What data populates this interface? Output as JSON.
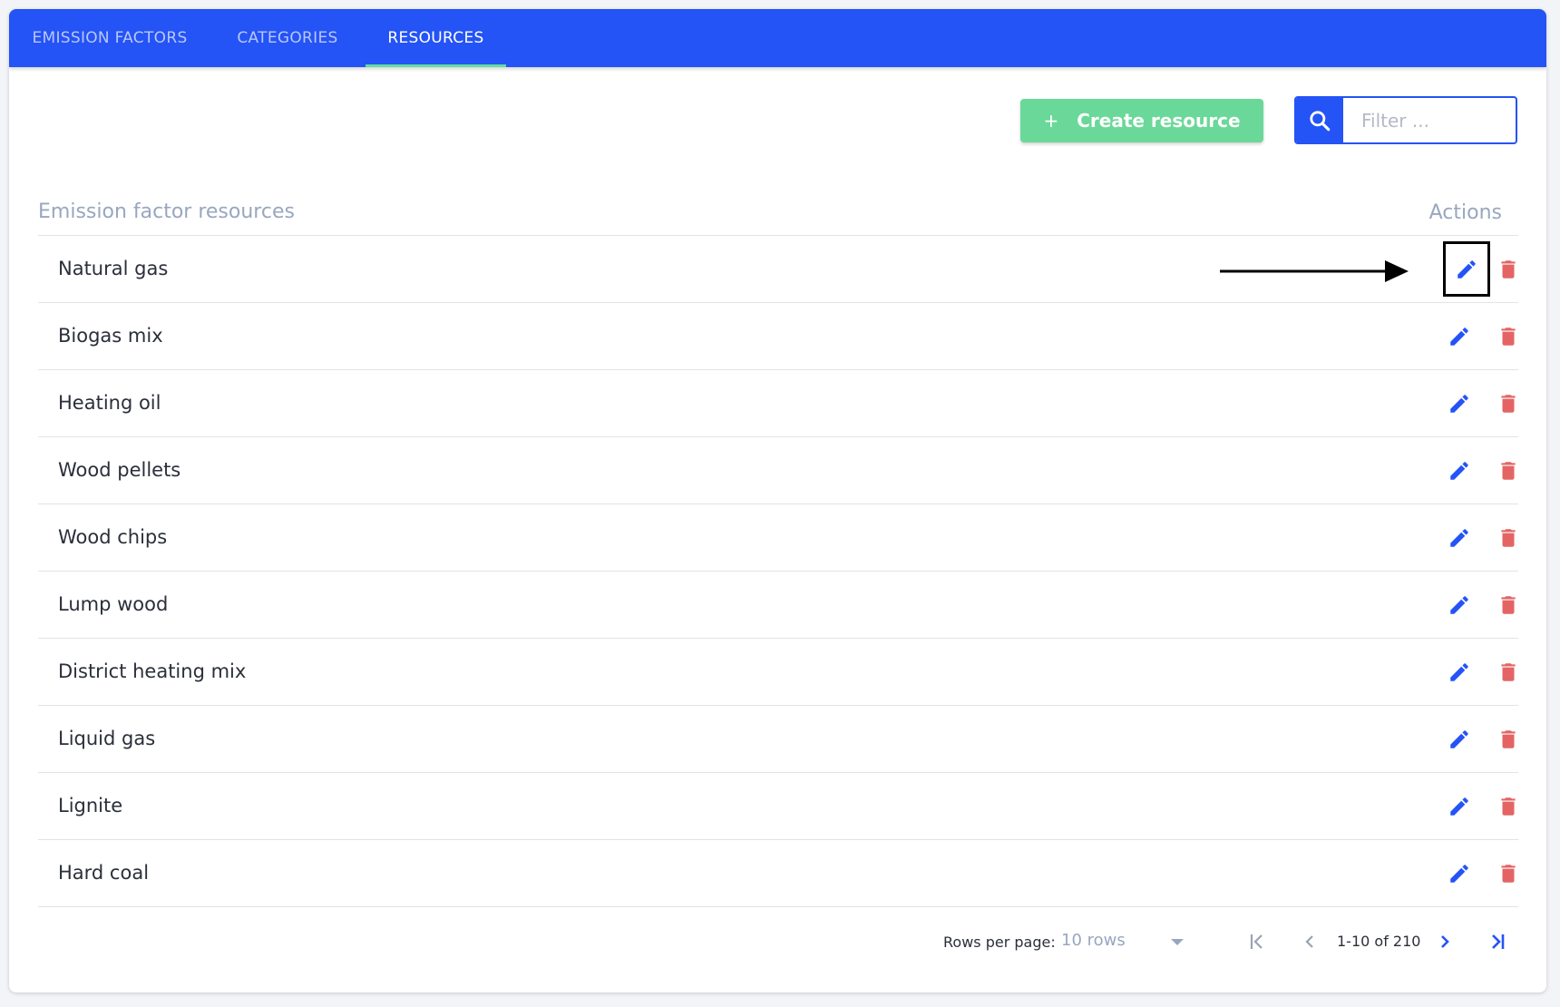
{
  "tabs": [
    {
      "label": "EMISSION FACTORS"
    },
    {
      "label": "CATEGORIES"
    },
    {
      "label": "RESOURCES"
    }
  ],
  "toolbar": {
    "create_icon": "plus-icon",
    "create_label": "Create resource",
    "search_icon": "search-icon",
    "filter_placeholder": "Filter ..."
  },
  "table": {
    "column_name": "Emission factor resources",
    "column_actions": "Actions",
    "rows": [
      {
        "name": "Natural gas"
      },
      {
        "name": "Biogas mix"
      },
      {
        "name": "Heating oil"
      },
      {
        "name": "Wood pellets"
      },
      {
        "name": "Wood chips"
      },
      {
        "name": "Lump wood"
      },
      {
        "name": "District heating mix"
      },
      {
        "name": "Liquid gas"
      },
      {
        "name": "Lignite"
      },
      {
        "name": "Hard coal"
      }
    ],
    "row_actions": {
      "edit_icon": "pencil-icon",
      "delete_icon": "trash-icon"
    }
  },
  "pagination": {
    "rows_per_page_label": "Rows per page:",
    "rows_per_page_value": "10 rows",
    "range_text": "1-10 of 210"
  },
  "colors": {
    "primary": "#2453f6",
    "tab_indicator": "#61dca0",
    "create_button": "#6ad898",
    "delete": "#e46464",
    "muted_text": "#98a7bf"
  }
}
